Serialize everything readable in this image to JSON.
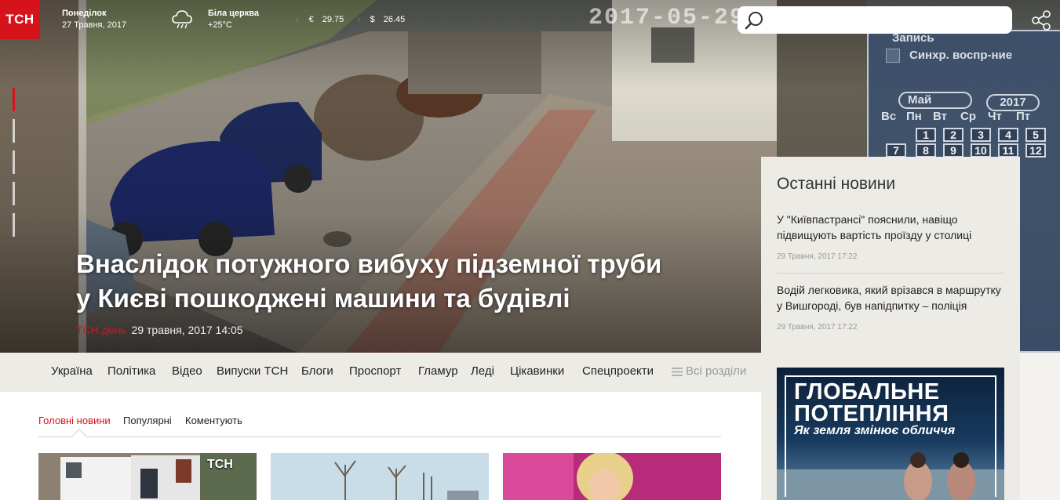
{
  "header": {
    "logo": "ТСН",
    "day": "Понеділок",
    "date": "27 Травня, 2017",
    "city": "Біла церква",
    "temp": "+25°С",
    "currencies": [
      {
        "symbol": "€",
        "value": "29.75"
      },
      {
        "symbol": "$",
        "value": "26.45"
      }
    ],
    "search_placeholder": ""
  },
  "hero": {
    "title_line1": "Внаслідок потужного вибуху підземної труби",
    "title_line2": "у Києві пошкоджені машини та будівлі",
    "source": "ТСН.день",
    "timestamp": "29 травня, 2017 14:05",
    "camera_stamp": "2017-05-29",
    "dvr": {
      "record_label": "Запись",
      "sync_label": "Синхр. воспр-ние",
      "month": "Май",
      "year": "2017",
      "weekdays": [
        "Вс",
        "Пн",
        "Вт",
        "Ср",
        "Чт",
        "Пт"
      ],
      "days_row1": [
        "1",
        "2",
        "3",
        "4",
        "5"
      ],
      "days_row2": [
        "7",
        "8",
        "9",
        "10",
        "11",
        "12"
      ]
    }
  },
  "nav": {
    "items": [
      "Україна",
      "Політика",
      "Відео",
      "Випуски ТСН",
      "Блоги",
      "Проспорт",
      "Гламур",
      "Леді",
      "Цікавинки",
      "Спецпроекти"
    ],
    "all_sections": "Всі розділи"
  },
  "tabs": [
    "Головні новини",
    "Популярні",
    "Коментують"
  ],
  "thumb_badge": "ТСН",
  "sidebar": {
    "title": "Останні новини",
    "items": [
      {
        "title": "У \"Київпастрансі\" пояснили, навіщо підвищують вартість проїзду у столиці",
        "time": "29 Травня, 2017 17:22"
      },
      {
        "title": "Водій легковика, який врізався в маршрутку у Вишгороді, був напідпитку – поліція",
        "time": "29 Травня, 2017 17:22"
      }
    ],
    "promo": {
      "line1": "ГЛОБАЛЬНЕ",
      "line2": "ПОТЕПЛІННЯ",
      "line3": "Як земля змінює обличчя"
    }
  },
  "colors": {
    "brand": "#d6131b",
    "currency_up": "#3bd16b"
  }
}
